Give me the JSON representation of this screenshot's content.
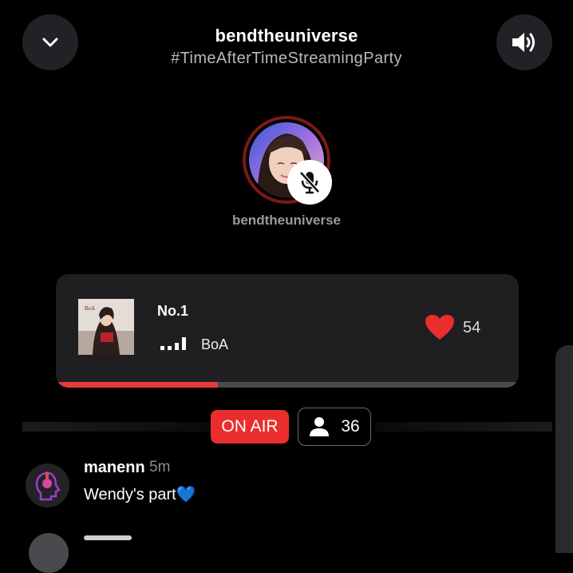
{
  "header": {
    "title": "bendtheuniverse",
    "subtitle": "#TimeAfterTimeStreamingParty"
  },
  "host": {
    "name": "bendtheuniverse",
    "mic_muted": true
  },
  "now_playing": {
    "title": "No.1",
    "artist": "BoA",
    "likes": "54",
    "progress": 0.35,
    "album_label": "BoA"
  },
  "status": {
    "on_air_label": "ON AIR",
    "listeners": "36"
  },
  "comments": [
    {
      "user": "manenn",
      "time": "5m",
      "text": "Wendy's part💙"
    }
  ],
  "icons": {
    "collapse": "chevron-down-icon",
    "volume": "speaker-volume-icon",
    "mute": "mic-off-icon",
    "heart": "heart-icon",
    "equalizer": "bars-icon",
    "listener": "person-icon"
  },
  "colors": {
    "accent": "#e63c3c",
    "on_air": "#ea2e2e",
    "card": "#1f1f22",
    "avatar_ring": "#7a1a1a"
  }
}
